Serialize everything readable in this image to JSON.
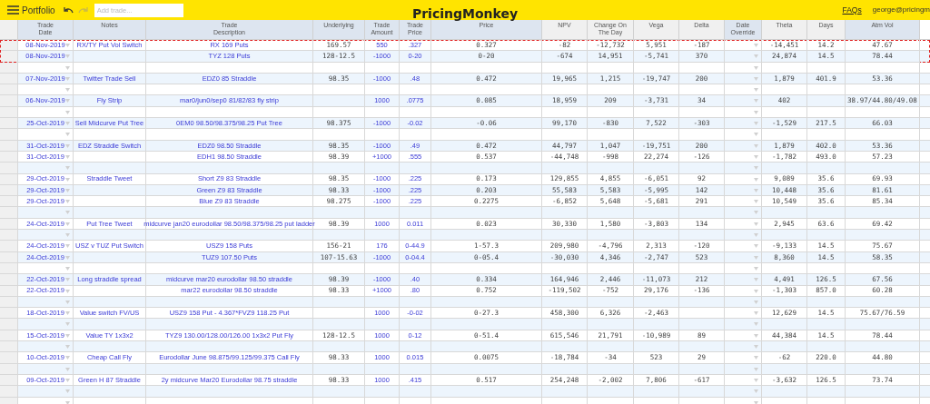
{
  "topbar": {
    "menu_label": "Portfolio",
    "search": {
      "placeholder": "Add trade..."
    },
    "title": "PricingMonkey",
    "links": [
      "FAQs"
    ],
    "user": "george@pricingm"
  },
  "table": {
    "columns": [
      {
        "label": "Trade\nDate",
        "kind": "entry",
        "dropdown": true
      },
      {
        "label": "Notes",
        "kind": "entry",
        "dropdown": false
      },
      {
        "label": "Trade\nDescription",
        "kind": "entry",
        "dropdown": false
      },
      {
        "label": "Underlying",
        "kind": "market",
        "dropdown": false
      },
      {
        "label": "Trade\nAmount",
        "kind": "entry",
        "dropdown": false
      },
      {
        "label": "Trade\nPrice",
        "kind": "entry",
        "dropdown": false
      },
      {
        "label": "Price",
        "kind": "market",
        "dropdown": false
      },
      {
        "label": "NPV",
        "kind": "calc",
        "dropdown": false
      },
      {
        "label": "Change On\nThe Day",
        "kind": "calc",
        "dropdown": false
      },
      {
        "label": "Vega",
        "kind": "calc",
        "dropdown": false
      },
      {
        "label": "Delta",
        "kind": "calc",
        "dropdown": false
      },
      {
        "label": "Date\nOverride",
        "kind": "market",
        "dropdown": true
      },
      {
        "label": "Theta",
        "kind": "calc",
        "dropdown": false
      },
      {
        "label": "Days",
        "kind": "calc",
        "dropdown": false
      },
      {
        "label": "Atm Vol",
        "kind": "market",
        "dropdown": false
      }
    ],
    "rows": [
      {
        "kind": "trade",
        "highlighted": true,
        "cells": [
          "08-Nov-2019",
          "RX/TY Put Vol Switch",
          "RX 169 Puts",
          "169.57",
          "550",
          ".327",
          "0.327",
          "-82",
          "-12,732",
          "5,951",
          "-187",
          null,
          "-14,451",
          "14.2",
          "47.67"
        ]
      },
      {
        "kind": "trade",
        "highlighted": true,
        "cells": [
          "08-Nov-2019",
          null,
          "TYZ 128 Puts",
          "128-12.5",
          "-1000",
          "0-20",
          "0-20",
          "-674",
          "14,951",
          "-5,741",
          "370",
          null,
          "24,874",
          "14.5",
          "78.44"
        ]
      },
      {
        "kind": "blank",
        "highlighted": false
      },
      {
        "kind": "trade",
        "highlighted": false,
        "cells": [
          "07-Nov-2019",
          "Twitter Trade Sell",
          "EDZ0 85 Straddle",
          "98.35",
          "-1000",
          ".48",
          "0.472",
          "19,965",
          "1,215",
          "-19,747",
          "200",
          null,
          "1,879",
          "401.9",
          "53.36"
        ]
      },
      {
        "kind": "blank",
        "highlighted": false
      },
      {
        "kind": "trade",
        "highlighted": false,
        "cells": [
          "06-Nov-2019",
          "Fly Strip",
          "mar0/jun0/sep0 81/82/83 fly strip",
          null,
          "1000",
          ".0775",
          "0.085",
          "18,959",
          "209",
          "-3,731",
          "34",
          null,
          "402",
          null,
          "38.97/44.80/49.08"
        ]
      },
      {
        "kind": "blank",
        "highlighted": false
      },
      {
        "kind": "trade",
        "highlighted": false,
        "cells": [
          "25-Oct-2019",
          "Sell Midcurve Put Tree",
          "0EM0 98.50/98.375/98.25 Put Tree",
          "98.375",
          "-1000",
          "-0.02",
          "-0.06",
          "99,170",
          "-830",
          "7,522",
          "-303",
          null,
          "-1,529",
          "217.5",
          "66.03"
        ]
      },
      {
        "kind": "blank",
        "highlighted": false
      },
      {
        "kind": "trade",
        "highlighted": false,
        "cells": [
          "31-Oct-2019",
          "EDZ Straddle Switch",
          "EDZ0 98.50 Straddle",
          "98.35",
          "-1000",
          ".49",
          "0.472",
          "44,797",
          "1,047",
          "-19,751",
          "200",
          null,
          "1,879",
          "402.0",
          "53.36"
        ]
      },
      {
        "kind": "trade",
        "highlighted": false,
        "cells": [
          "31-Oct-2019",
          null,
          "EDH1 98.50 Straddle",
          "98.39",
          "+1000",
          ".555",
          "0.537",
          "-44,748",
          "-998",
          "22,274",
          "-126",
          null,
          "-1,782",
          "493.0",
          "57.23"
        ]
      },
      {
        "kind": "blank",
        "highlighted": false
      },
      {
        "kind": "trade",
        "highlighted": false,
        "cells": [
          "29-Oct-2019",
          "Straddle Tweet",
          "Short Z9 83 Straddle",
          "98.35",
          "-1000",
          ".225",
          "0.173",
          "129,855",
          "4,855",
          "-6,051",
          "92",
          null,
          "9,089",
          "35.6",
          "69.93"
        ]
      },
      {
        "kind": "trade",
        "highlighted": false,
        "cells": [
          "29-Oct-2019",
          null,
          "Green Z9 83 Straddle",
          "98.33",
          "-1000",
          ".225",
          "0.203",
          "55,583",
          "5,583",
          "-5,995",
          "142",
          null,
          "10,448",
          "35.6",
          "81.61"
        ]
      },
      {
        "kind": "trade",
        "highlighted": false,
        "cells": [
          "29-Oct-2019",
          null,
          "Blue Z9 83 Straddle",
          "98.275",
          "-1000",
          ".225",
          "0.2275",
          "-6,852",
          "5,648",
          "-5,681",
          "291",
          null,
          "10,549",
          "35.6",
          "85.34"
        ]
      },
      {
        "kind": "blank",
        "highlighted": false
      },
      {
        "kind": "trade",
        "highlighted": false,
        "cells": [
          "24-Oct-2019",
          "Put Tree Tweet",
          "midcurve jan20 eurodollar 98.50/98.375/98.25 put ladder",
          "98.39",
          "1000",
          "0.011",
          "0.023",
          "30,330",
          "1,580",
          "-3,803",
          "134",
          null,
          "2,945",
          "63.6",
          "69.42"
        ]
      },
      {
        "kind": "blank",
        "highlighted": false
      },
      {
        "kind": "trade",
        "highlighted": false,
        "cells": [
          "24-Oct-2019",
          "USZ v TUZ Put Switch",
          "USZ9 158 Puts",
          "156-21",
          "176",
          "0-44.9",
          "1-57.3",
          "209,980",
          "-4,796",
          "2,313",
          "-120",
          null,
          "-9,133",
          "14.5",
          "75.67"
        ]
      },
      {
        "kind": "trade",
        "highlighted": false,
        "cells": [
          "24-Oct-2019",
          null,
          "TUZ9 107.50 Puts",
          "107-15.63",
          "-1000",
          "0-04.4",
          "0-05.4",
          "-30,030",
          "4,346",
          "-2,747",
          "523",
          null,
          "8,360",
          "14.5",
          "58.35"
        ]
      },
      {
        "kind": "blank",
        "highlighted": false
      },
      {
        "kind": "trade",
        "highlighted": false,
        "cells": [
          "22-Oct-2019",
          "Long straddle spread",
          "midcurve mar20 eurodollar 98.50 straddle",
          "98.39",
          "-1000",
          ".40",
          "0.334",
          "164,946",
          "2,446",
          "-11,073",
          "212",
          null,
          "4,491",
          "126.5",
          "67.56"
        ]
      },
      {
        "kind": "trade",
        "highlighted": false,
        "cells": [
          "22-Oct-2019",
          null,
          "mar22 eurodollar 98.50 straddle",
          "98.33",
          "+1000",
          ".80",
          "0.752",
          "-119,502",
          "-752",
          "29,176",
          "-136",
          null,
          "-1,303",
          "857.0",
          "60.28"
        ]
      },
      {
        "kind": "blank",
        "highlighted": false
      },
      {
        "kind": "trade",
        "highlighted": false,
        "cells": [
          "18-Oct-2019",
          "Value switch FV/US",
          "USZ9 158 Put - 4.367*FVZ9 118.25 Put",
          null,
          "1000",
          "-0-02",
          "0-27.3",
          "458,300",
          "6,326",
          "-2,463",
          null,
          null,
          "12,629",
          "14.5",
          "75.67/76.59"
        ]
      },
      {
        "kind": "blank",
        "highlighted": false
      },
      {
        "kind": "trade",
        "highlighted": false,
        "cells": [
          "15-Oct-2019",
          "Value TY 1x3x2",
          "TYZ9 130.00/128.00/126.00 1x3x2 Put Fly",
          "128-12.5",
          "1000",
          "0-12",
          "0-51.4",
          "615,546",
          "21,791",
          "-10,989",
          "89",
          null,
          "44,384",
          "14.5",
          "78.44"
        ]
      },
      {
        "kind": "blank",
        "highlighted": false
      },
      {
        "kind": "trade",
        "highlighted": false,
        "cells": [
          "10-Oct-2019",
          "Cheap Call Fly",
          "Eurodollar June 98.875/99.125/99.375 Call Fly",
          "98.33",
          "1000",
          "0.015",
          "0.0075",
          "-18,784",
          "-34",
          "523",
          "29",
          null,
          "-62",
          "220.0",
          "44.80"
        ]
      },
      {
        "kind": "blank",
        "highlighted": false
      },
      {
        "kind": "trade",
        "highlighted": false,
        "cells": [
          "09-Oct-2019",
          "Green H 87 Straddle",
          "2y midcurve Mar20 Eurodollar 98.75 straddle",
          "98.33",
          "1000",
          ".415",
          "0.517",
          "254,248",
          "-2,002",
          "7,806",
          "-617",
          null,
          "-3,632",
          "126.5",
          "73.74"
        ]
      },
      {
        "kind": "blank",
        "highlighted": false
      },
      {
        "kind": "blank",
        "highlighted": false
      }
    ]
  }
}
